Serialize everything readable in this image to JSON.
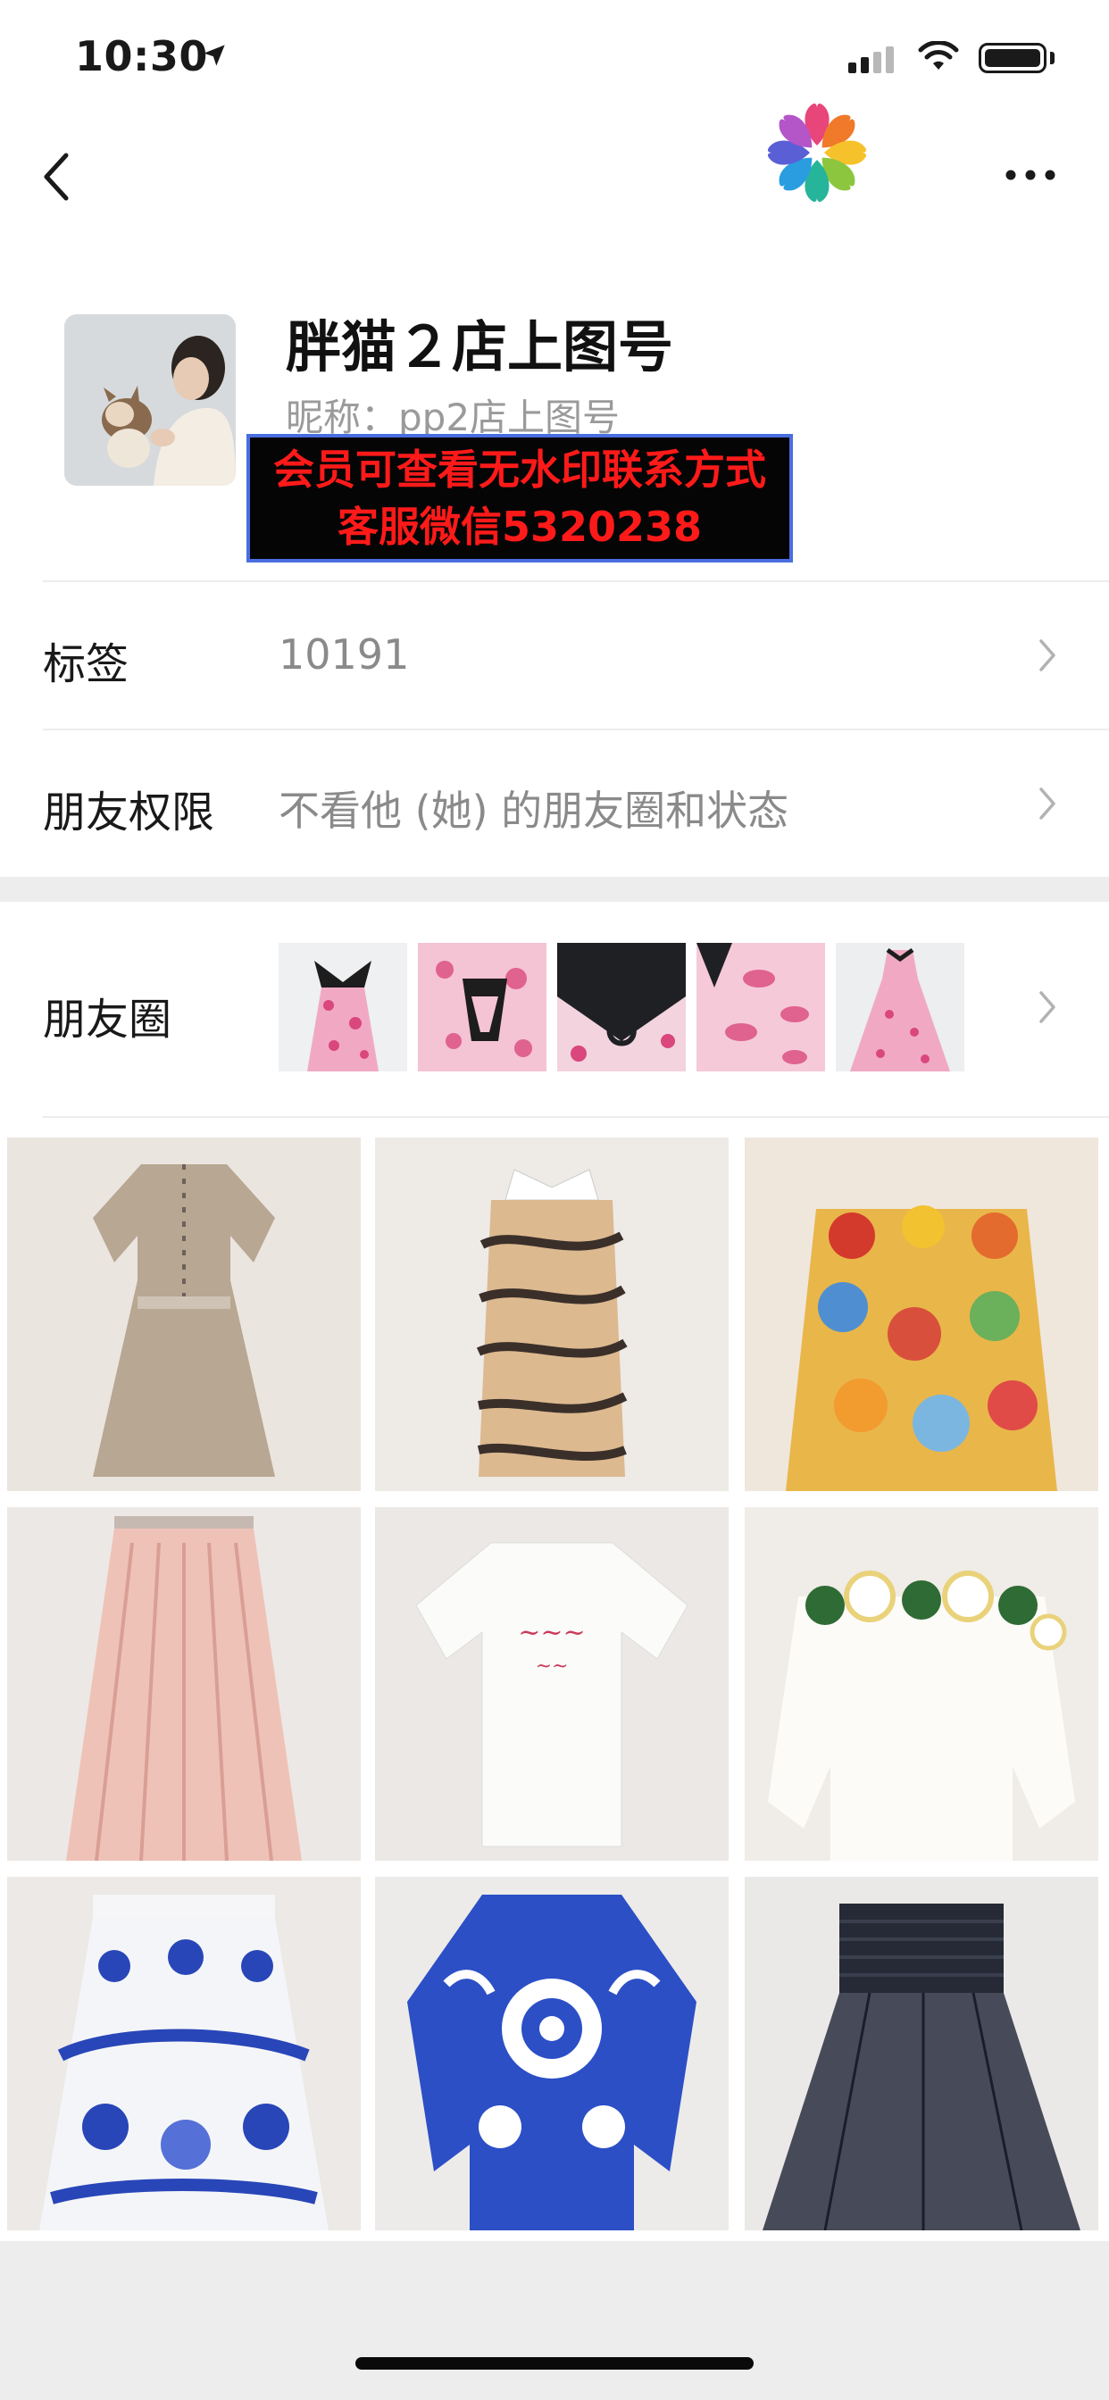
{
  "status_bar": {
    "time": "10:30"
  },
  "profile": {
    "name": "胖猫２店上图号",
    "nickname": "昵称：pp2店上图号",
    "promo_line1": "会员可查看无水印联系方式",
    "promo_line2": "客服微信5320238"
  },
  "rows": {
    "tags_label": "标签",
    "tags_value": "10191",
    "permission_label": "朋友权限",
    "permission_value": "不看他 (她) 的朋友圈和状态",
    "moments_label": "朋友圈"
  },
  "moments_thumbnails": [
    "pink-floral-dress-front",
    "pink-floral-dress-collar",
    "black-collar-detail",
    "pink-floral-fabric",
    "pink-floral-dress-full"
  ],
  "photo_grid": [
    "beige-belted-shirt-dress",
    "tiger-stripe-knit-dress",
    "floral-pleated-dress",
    "pink-pleated-skirt",
    "white-slogan-tshirt",
    "white-floral-embroidered-blouse",
    "blue-porcelain-print-skirt",
    "blue-porcelain-print-sweater",
    "navy-tulle-skirt"
  ],
  "colors": {
    "promo_text": "#ff1a1a",
    "promo_bg": "#050505",
    "promo_border": "#4a6ee0"
  }
}
